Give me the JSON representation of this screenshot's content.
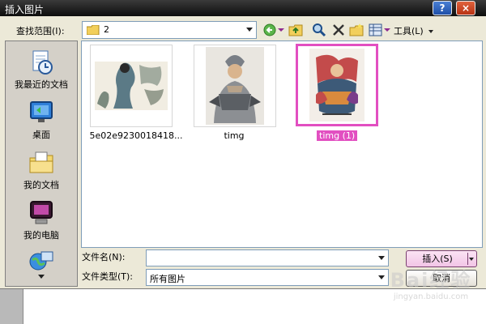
{
  "dialog": {
    "title": "插入图片",
    "help_label": "?",
    "close_label": "×"
  },
  "toolbar": {
    "look_in_label": "查找范围(I):",
    "look_in_value": "2",
    "tools_label": "工具(L)",
    "icons": [
      "back-icon",
      "up-folder-icon",
      "search-web-icon",
      "delete-icon",
      "new-folder-icon",
      "views-icon"
    ]
  },
  "places": [
    {
      "label": "我最近的文档",
      "icon": "recent-documents-icon"
    },
    {
      "label": "桌面",
      "icon": "desktop-icon"
    },
    {
      "label": "我的文档",
      "icon": "my-documents-icon"
    },
    {
      "label": "我的电脑",
      "icon": "my-computer-icon"
    },
    {
      "label": "",
      "icon": "network-places-icon"
    }
  ],
  "files": [
    {
      "name": "5e02e9230018418...",
      "selected": false
    },
    {
      "name": "timg",
      "selected": false
    },
    {
      "name": "timg (1)",
      "selected": true
    }
  ],
  "footer": {
    "filename_label": "文件名(N):",
    "filename_value": "",
    "filetype_label": "文件类型(T):",
    "filetype_value": "所有图片",
    "insert_label": "插入(S)",
    "cancel_label": "取消"
  },
  "watermark": {
    "big": "Bai经验",
    "small": "jingyan.baidu.com"
  },
  "colors": {
    "selection": "#e24fc1",
    "dialog_bg": "#ece9d8",
    "titlebar": "#1a1a1a"
  }
}
